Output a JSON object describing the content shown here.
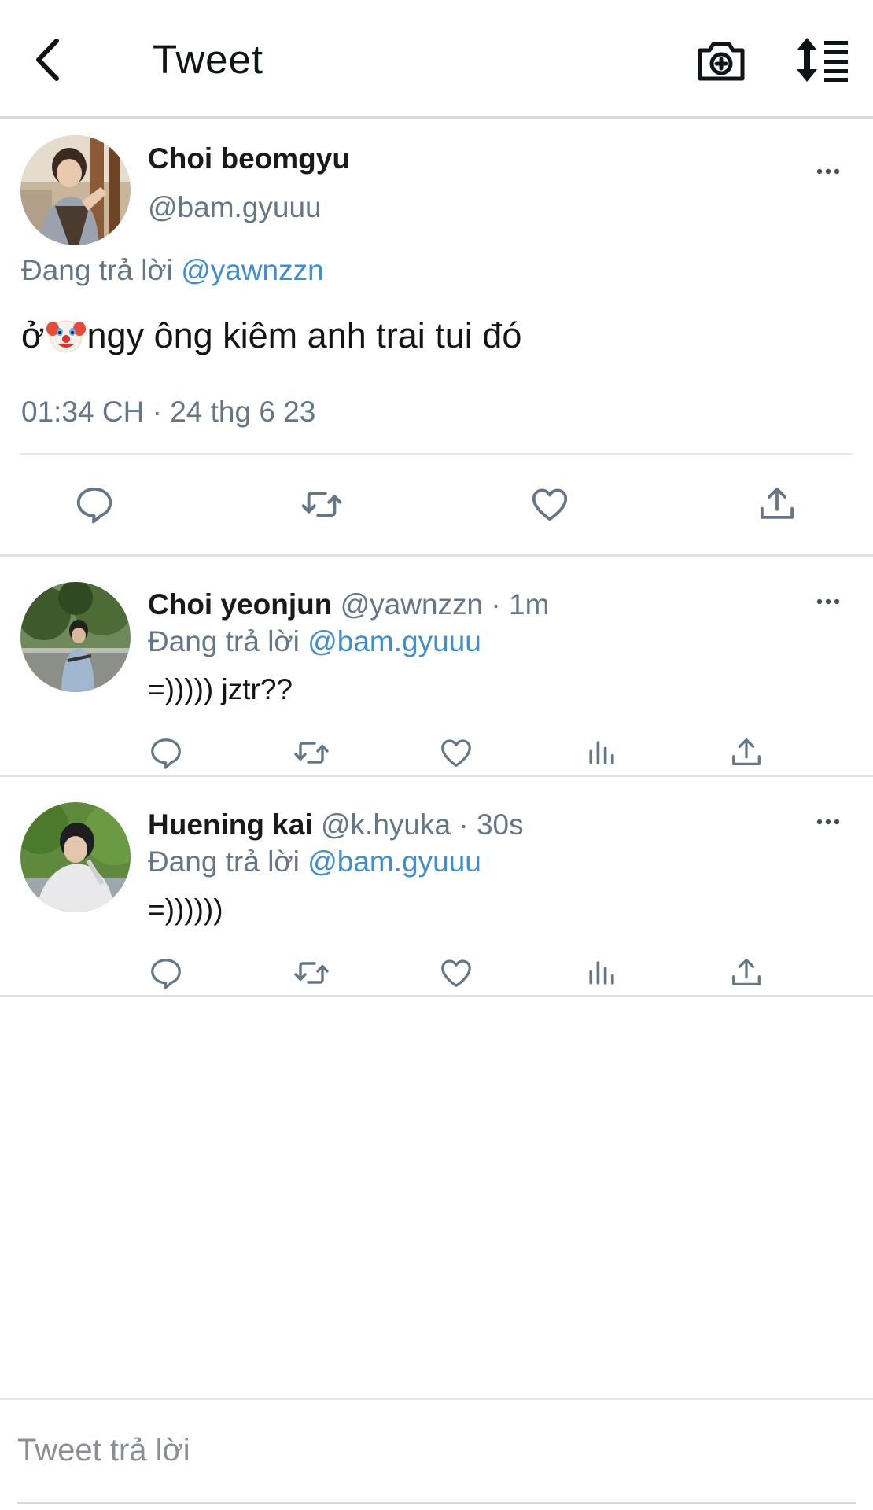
{
  "header": {
    "title": "Tweet",
    "icons": [
      "back-arrow-icon",
      "camera-plus-icon",
      "sort-icon"
    ]
  },
  "main_tweet": {
    "author_name": "Choi beomgyu",
    "author_handle": "@bam.gyuuu",
    "replying_label": "Đang trả lời",
    "replying_to": "@yawnzzn",
    "text_before_emoji": "ở",
    "emoji": "clown-face-emoji",
    "text_after_emoji": "ngy ông kiêm anh trai tui đó",
    "timestamp": "01:34 CH · 24 thg 6 23",
    "actions": [
      "reply-icon",
      "retweet-icon",
      "like-icon",
      "share-icon"
    ]
  },
  "replies": [
    {
      "author_name": "Choi yeonjun",
      "meta": "@yawnzzn · 1m",
      "replying_label": "Đang trả lời",
      "replying_to": "@bam.gyuuu",
      "text": "=))))) jztr??",
      "actions": [
        "reply-icon",
        "retweet-icon",
        "like-icon",
        "analytics-icon",
        "share-icon"
      ]
    },
    {
      "author_name": "Huening kai",
      "meta": "@k.hyuka · 30s",
      "replying_label": "Đang trả lời",
      "replying_to": "@bam.gyuuu",
      "text": "=))))))",
      "actions": [
        "reply-icon",
        "retweet-icon",
        "like-icon",
        "analytics-icon",
        "share-icon"
      ]
    }
  ],
  "compose": {
    "placeholder": "Tweet trả lời"
  },
  "colors": {
    "mention": "#3e8ed0",
    "secondary_text": "#657786",
    "divider": "#e1e1e1",
    "icon_gray": "#657786"
  }
}
